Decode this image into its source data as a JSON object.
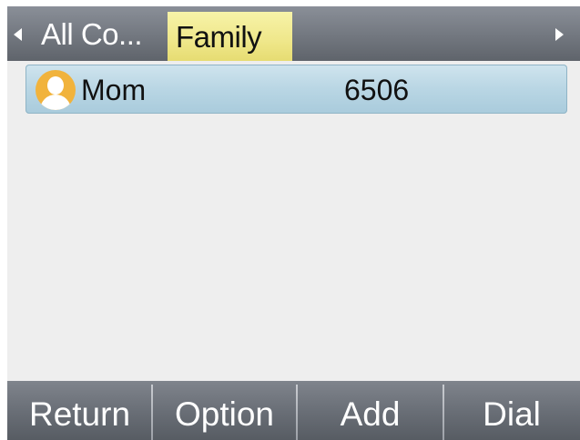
{
  "tabs": [
    {
      "label": "All Co...",
      "selected": false
    },
    {
      "label": "Family",
      "selected": true
    }
  ],
  "contacts": [
    {
      "name": "Mom",
      "number": "6506",
      "selected": true
    }
  ],
  "softkeys": {
    "return_label": "Return",
    "option_label": "Option",
    "add_label": "Add",
    "dial_label": "Dial"
  },
  "icons": {
    "tab_prev": "arrow-left-icon",
    "tab_next": "arrow-right-icon",
    "contact_avatar": "person-avatar-icon"
  },
  "colors": {
    "selected_tab": "#efe78a",
    "selected_row": "#b9d6e4",
    "avatar": "#f1b33c",
    "bar": "#6e737b"
  }
}
